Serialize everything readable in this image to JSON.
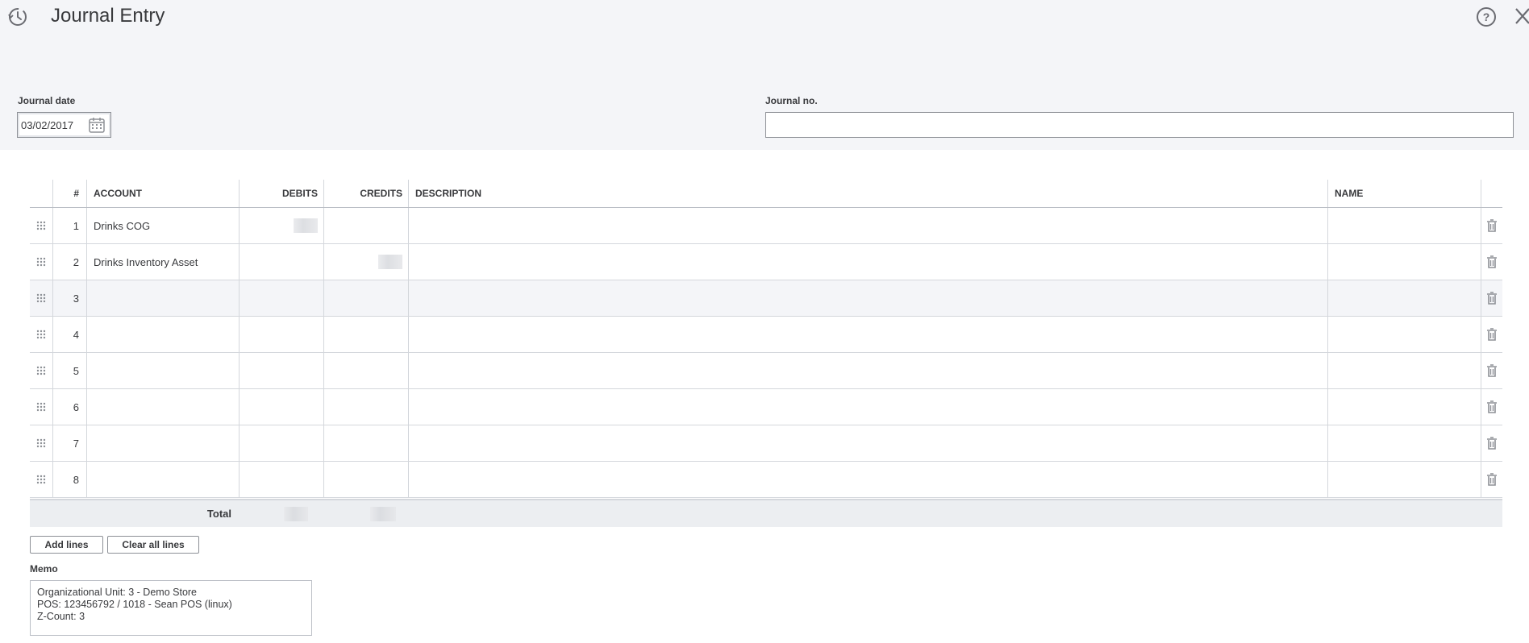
{
  "header": {
    "title": "Journal Entry",
    "history_icon": "history-clock-icon",
    "help_icon": "help-icon",
    "close_icon": "close-icon"
  },
  "form": {
    "journal_date_label": "Journal date",
    "journal_date_value": "03/02/2017",
    "journal_no_label": "Journal no.",
    "journal_no_value": ""
  },
  "grid": {
    "columns": {
      "num": "#",
      "account": "ACCOUNT",
      "debits": "DEBITS",
      "credits": "CREDITS",
      "description": "DESCRIPTION",
      "name": "NAME"
    },
    "rows": [
      {
        "num": "1",
        "account": "Drinks COG",
        "debits": "",
        "credits": "",
        "description": "",
        "name": ""
      },
      {
        "num": "2",
        "account": "Drinks Inventory Asset",
        "debits": "",
        "credits": "",
        "description": "",
        "name": ""
      },
      {
        "num": "3",
        "account": "",
        "debits": "",
        "credits": "",
        "description": "",
        "name": ""
      },
      {
        "num": "4",
        "account": "",
        "debits": "",
        "credits": "",
        "description": "",
        "name": ""
      },
      {
        "num": "5",
        "account": "",
        "debits": "",
        "credits": "",
        "description": "",
        "name": ""
      },
      {
        "num": "6",
        "account": "",
        "debits": "",
        "credits": "",
        "description": "",
        "name": ""
      },
      {
        "num": "7",
        "account": "",
        "debits": "",
        "credits": "",
        "description": "",
        "name": ""
      },
      {
        "num": "8",
        "account": "",
        "debits": "",
        "credits": "",
        "description": "",
        "name": ""
      }
    ],
    "total_label": "Total"
  },
  "actions": {
    "add_lines": "Add lines",
    "clear_all_lines": "Clear all lines"
  },
  "memo": {
    "label": "Memo",
    "lines": [
      "Organizational Unit: 3 - Demo Store",
      "POS: 123456792 / 1018 - Sean POS (linux)",
      "Z-Count: 3"
    ]
  },
  "colors": {
    "header_bg": "#f4f5f8",
    "text": "#393a3d",
    "border": "#d4d7dc"
  }
}
